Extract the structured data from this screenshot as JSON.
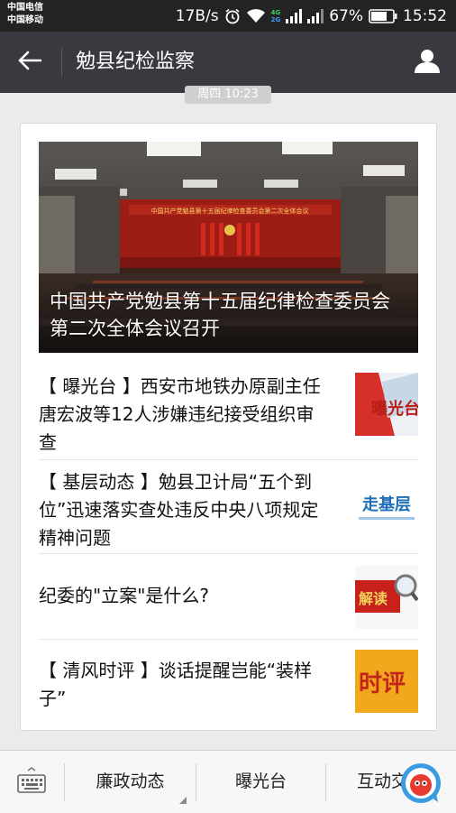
{
  "status_bar": {
    "carrier_1": "中国电信",
    "carrier_2": "中国移动",
    "speed": "17B/s",
    "net_4g": "4G",
    "net_2g": "2G",
    "battery": "67%",
    "time": "15:52"
  },
  "nav": {
    "title": "勉县纪检监察",
    "back_icon": "back-arrow-icon",
    "profile_icon": "person-icon"
  },
  "chat": {
    "timestamp": "周四 10:23"
  },
  "article_card": {
    "hero": {
      "banner_text": "中国共产党勉县第十五届纪律检查委员会第二次全体会议",
      "title": "中国共产党勉县第十五届纪律检查委员会第二次全体会议召开"
    },
    "items": [
      {
        "title": "【 曝光台 】西安市地铁办原副主任唐宏波等12人涉嫌违纪接受组织审查",
        "thumb_text": "曝光台"
      },
      {
        "title": "【 基层动态 】勉县卫计局“五个到位”迅速落实查处违反中央八项规定精神问题",
        "thumb_text": "走基层"
      },
      {
        "title": "纪委的\"立案\"是什么?",
        "thumb_text": "解读"
      },
      {
        "title": "【 清风时评 】谈话提醒岂能“装样子”",
        "thumb_text": "时评"
      }
    ]
  },
  "bottom_menu": {
    "keyboard_icon": "keyboard-icon",
    "items": [
      "廉政动态",
      "曝光台",
      "互动交流"
    ]
  },
  "colors": {
    "status_bg": "#232323",
    "nav_bg": "#393a3f",
    "page_bg": "#ebebeb",
    "card_bg": "#ffffff"
  }
}
